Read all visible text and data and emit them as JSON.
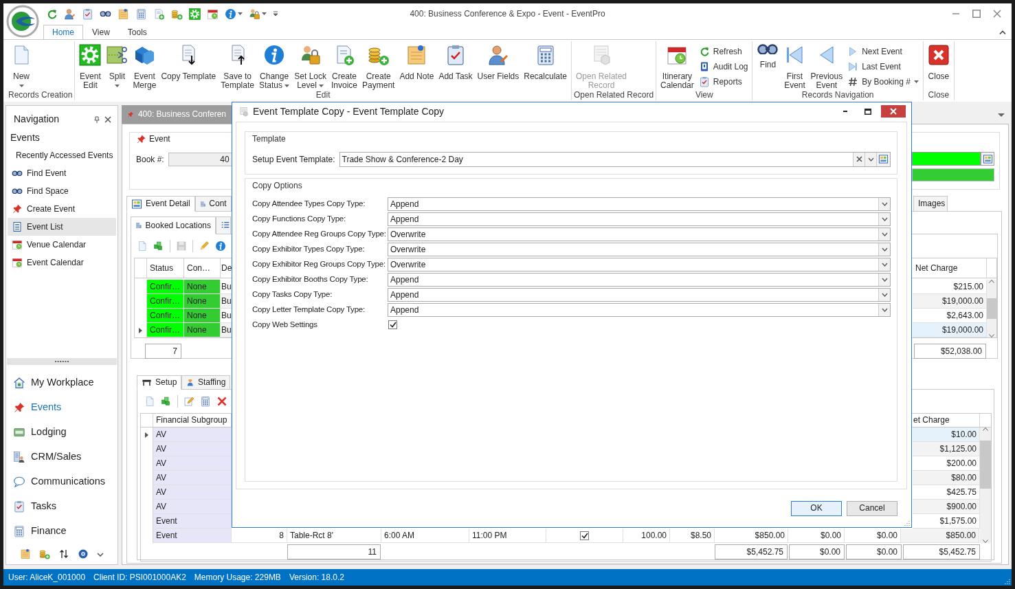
{
  "window": {
    "title": "400: Business Conference & Expo - Event - EventPro"
  },
  "ribbon": {
    "tabs": [
      {
        "label": "Home",
        "selected": true
      },
      {
        "label": "View",
        "selected": false
      },
      {
        "label": "Tools",
        "selected": false
      }
    ],
    "groups": [
      {
        "label": "Records Creation",
        "buttons": [
          {
            "kind": "large",
            "lines": [
              "New"
            ],
            "menu": true,
            "disabled": false
          }
        ]
      },
      {
        "label": "Edit",
        "buttons": [
          {
            "kind": "large",
            "lines": [
              "Event",
              "Edit"
            ],
            "menu": false,
            "disabled": false
          },
          {
            "kind": "large",
            "lines": [
              "Split"
            ],
            "menu": true,
            "disabled": false
          },
          {
            "kind": "large",
            "lines": [
              "Event",
              "Merge"
            ],
            "menu": false,
            "disabled": false
          },
          {
            "kind": "large",
            "lines": [
              "Copy Template"
            ],
            "menu": false,
            "disabled": false
          },
          {
            "kind": "large",
            "lines": [
              "Save to",
              "Template"
            ],
            "menu": false,
            "disabled": false
          },
          {
            "kind": "large",
            "lines": [
              "Change",
              "Status"
            ],
            "menu": true,
            "disabled": false
          },
          {
            "kind": "large",
            "lines": [
              "Set Lock",
              "Level"
            ],
            "menu": true,
            "disabled": false
          },
          {
            "kind": "large",
            "lines": [
              "Create",
              "Invoice"
            ],
            "menu": false,
            "disabled": false
          },
          {
            "kind": "large",
            "lines": [
              "Create",
              "Payment"
            ],
            "menu": false,
            "disabled": false
          },
          {
            "kind": "large",
            "lines": [
              "Add Note"
            ],
            "menu": false,
            "disabled": false
          },
          {
            "kind": "large",
            "lines": [
              "Add Task"
            ],
            "menu": false,
            "disabled": false
          },
          {
            "kind": "large",
            "lines": [
              "User Fields"
            ],
            "menu": false,
            "disabled": false
          },
          {
            "kind": "large",
            "lines": [
              "Recalculate"
            ],
            "menu": false,
            "disabled": false
          }
        ]
      },
      {
        "label": "Open Related Record",
        "buttons": [
          {
            "kind": "large",
            "lines": [
              "Open Related",
              "Record"
            ],
            "menu": false,
            "disabled": true
          }
        ]
      },
      {
        "label": "View",
        "buttons": [
          {
            "kind": "large",
            "lines": [
              "Itinerary",
              "Calendar"
            ],
            "menu": false,
            "disabled": false
          },
          {
            "kind": "small",
            "lines": [
              "Refresh"
            ],
            "menu": false,
            "disabled": false
          },
          {
            "kind": "small",
            "lines": [
              "Audit Log"
            ],
            "menu": false,
            "disabled": false
          },
          {
            "kind": "small",
            "lines": [
              "Reports"
            ],
            "menu": false,
            "disabled": false
          }
        ]
      },
      {
        "label": "Records Navigation",
        "buttons": [
          {
            "kind": "large",
            "lines": [
              "Find"
            ],
            "menu": false,
            "disabled": false
          },
          {
            "kind": "large",
            "lines": [
              "First",
              "Event"
            ],
            "menu": false,
            "disabled": false
          },
          {
            "kind": "large",
            "lines": [
              "Previous",
              "Event"
            ],
            "menu": false,
            "disabled": false
          },
          {
            "kind": "small",
            "lines": [
              "Next Event"
            ],
            "menu": false,
            "disabled": false
          },
          {
            "kind": "small",
            "lines": [
              "Last Event"
            ],
            "menu": false,
            "disabled": false
          },
          {
            "kind": "small",
            "lines": [
              "By Booking #"
            ],
            "menu": true,
            "disabled": false
          }
        ]
      },
      {
        "label": "Close",
        "buttons": [
          {
            "kind": "large",
            "lines": [
              "Close"
            ],
            "menu": false,
            "disabled": false
          }
        ]
      }
    ]
  },
  "navigation": {
    "title": "Navigation",
    "section": "Events",
    "items": [
      {
        "label": "Recently Accessed Events",
        "selected": false
      },
      {
        "label": "Find Event",
        "selected": false
      },
      {
        "label": "Find Space",
        "selected": false
      },
      {
        "label": "Create Event",
        "selected": false
      },
      {
        "label": "Event List",
        "selected": true
      },
      {
        "label": "Venue Calendar",
        "selected": false
      },
      {
        "label": "Event Calendar",
        "selected": false
      }
    ],
    "modules": [
      {
        "label": "My Workplace",
        "selected": false
      },
      {
        "label": "Events",
        "selected": true
      },
      {
        "label": "Lodging",
        "selected": false
      },
      {
        "label": "CRM/Sales",
        "selected": false
      },
      {
        "label": "Communications",
        "selected": false
      },
      {
        "label": "Tasks",
        "selected": false
      },
      {
        "label": "Finance",
        "selected": false
      }
    ]
  },
  "document": {
    "tab": "400: Business Conferen",
    "event": {
      "legend": "Event",
      "book_label": "Book #:",
      "book_value": "40"
    },
    "detail_tabs": [
      {
        "label": "Event Detail",
        "selected": true
      },
      {
        "label": "Cont",
        "selected": false
      },
      {
        "label": "Images",
        "selected": false
      }
    ],
    "locations": {
      "tabs": [
        {
          "kind": "text",
          "label": "Booked Locations",
          "selected": true
        },
        {
          "kind": "icon",
          "selected": false
        }
      ],
      "columns": [
        "Status",
        "Con…",
        "De"
      ],
      "net_column": "Net Charge",
      "rows": [
        {
          "cells": [
            "Confir…",
            "None",
            "Bu"
          ],
          "net_charge": "$215.00",
          "current": false
        },
        {
          "cells": [
            "Confir…",
            "None",
            "Bu"
          ],
          "net_charge": "$19,000.00",
          "current": false
        },
        {
          "cells": [
            "Confir…",
            "None",
            "Bu"
          ],
          "net_charge": "$2,643.00",
          "current": false
        },
        {
          "cells": [
            "Confir…",
            "None",
            "Bu"
          ],
          "net_charge": "$19,000.00",
          "current": true
        }
      ],
      "count": "7",
      "total": "$52,038.00"
    },
    "charges": {
      "tabs": [
        {
          "label": "Setup",
          "selected": true
        },
        {
          "label": "Staffing",
          "selected": false
        }
      ],
      "sort_column": "Financial Subgroup",
      "net_column": "et Charge",
      "rows": [
        {
          "subgroup": "AV",
          "net_charge": "$10.00",
          "current": true
        },
        {
          "subgroup": "AV",
          "net_charge": "$1,125.00",
          "current": false
        },
        {
          "subgroup": "AV",
          "net_charge": "$200.00",
          "current": false
        },
        {
          "subgroup": "AV",
          "net_charge": "$80.00",
          "current": false
        },
        {
          "subgroup": "AV",
          "net_charge": "$425.75",
          "current": false
        },
        {
          "subgroup": "AV",
          "net_charge": "$900.00",
          "current": false
        },
        {
          "subgroup": "Event",
          "net_charge": "$1,575.00",
          "current": false
        },
        {
          "subgroup": "Event",
          "net_charge": "$850.00",
          "current": false,
          "cells": [
            {
              "kind": "number",
              "text": "8"
            },
            {
              "kind": "text",
              "text": "Table-Rct 8'"
            },
            {
              "kind": "text",
              "text": "6:00 AM"
            },
            {
              "kind": "text",
              "text": "11:00 PM"
            },
            {
              "kind": "checkbox",
              "checked": true
            },
            {
              "kind": "number",
              "text": "100.00"
            },
            {
              "kind": "number",
              "text": "$8.50"
            },
            {
              "kind": "number",
              "text": "$850.00"
            },
            {
              "kind": "number",
              "text": "$0.00"
            },
            {
              "kind": "number",
              "text": "$0.00"
            }
          ]
        }
      ],
      "count": "11",
      "totals": [
        "$5,452.75",
        "$0.00",
        "$0.00",
        "$5,452.75"
      ]
    }
  },
  "dialog": {
    "title": "Event Template Copy - Event Template Copy",
    "template_legend": "Template",
    "template_label": "Setup Event Template:",
    "template_value": "Trade Show & Conference-2 Day",
    "options_legend": "Copy Options",
    "options": [
      {
        "kind": "select",
        "label": "Copy Attendee Types Copy Type:",
        "value": "Append"
      },
      {
        "kind": "select",
        "label": "Copy Functions Copy Type:",
        "value": "Append"
      },
      {
        "kind": "select",
        "label": "Copy Attendee Reg Groups Copy Type:",
        "value": "Overwrite"
      },
      {
        "kind": "select",
        "label": "Copy Exhibitor Types Copy Type:",
        "value": "Overwrite"
      },
      {
        "kind": "select",
        "label": "Copy Exhibitor Reg Groups Copy Type:",
        "value": "Overwrite"
      },
      {
        "kind": "select",
        "label": "Copy Exhibitor Booths Copy Type:",
        "value": "Append"
      },
      {
        "kind": "select",
        "label": "Copy Tasks Copy Type:",
        "value": "Append"
      },
      {
        "kind": "select",
        "label": "Copy Letter Template Copy Type:",
        "value": "Append"
      },
      {
        "kind": "checkbox",
        "label": "Copy Web Settings",
        "checked": true
      }
    ],
    "buttons": [
      {
        "label": "OK",
        "default": true
      },
      {
        "label": "Cancel",
        "default": false
      }
    ]
  },
  "status_bar": [
    "User: AliceK_001000",
    "Client ID: PSI001000AK2",
    "Memory Usage: 229MB",
    "Version: 18.0.2"
  ]
}
